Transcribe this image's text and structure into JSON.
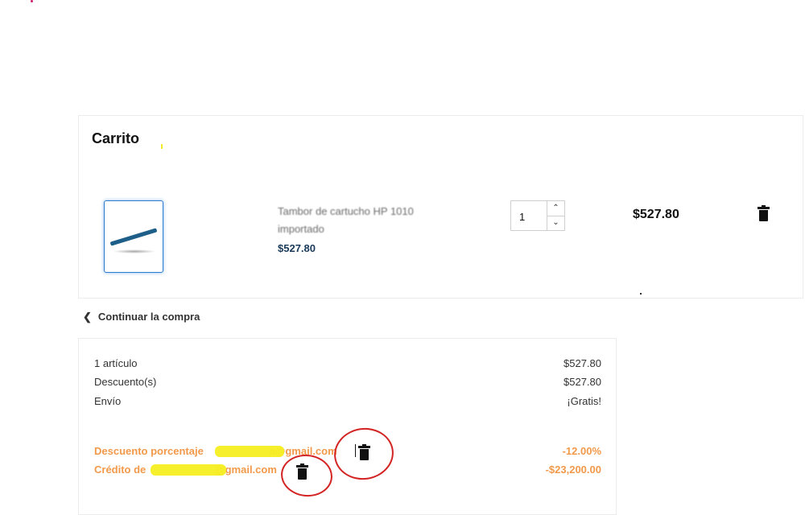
{
  "cart": {
    "title": "Carrito",
    "item": {
      "name": "Tambor de cartucho HP 1010 importado",
      "unit_price": "$527.80",
      "quantity": "1",
      "line_total": "$527.80"
    }
  },
  "continue_label": "Continuar la compra",
  "summary": {
    "rows": [
      {
        "label": "1 artículo",
        "value": "$527.80"
      },
      {
        "label": "Descuento(s)",
        "value": "$527.80"
      },
      {
        "label": "Envío",
        "value": "¡Gratis!"
      }
    ],
    "discounts": [
      {
        "label_prefix": "Descuento porcentaje",
        "email_suffix": "a@gmail.com",
        "value": "-12.00%"
      },
      {
        "label_prefix": "Crédito de",
        "email_suffix": "@gmail.com",
        "value": "-$23,200.00"
      }
    ]
  },
  "colors": {
    "accent_orange": "#f2994a",
    "highlight_yellow": "#f5ee20",
    "annotation_red": "#d32323",
    "thumb_border": "#2e7bd3"
  },
  "icons": [
    "trash-icon",
    "chevron-left-icon",
    "chevron-up-icon",
    "chevron-down-icon"
  ]
}
